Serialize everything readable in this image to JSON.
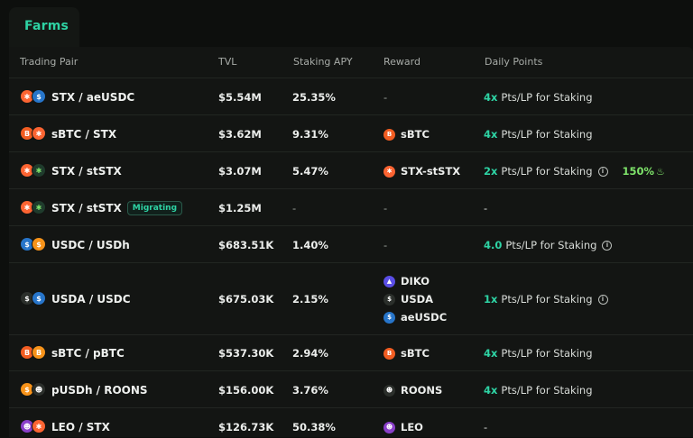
{
  "tab": {
    "label": "Farms"
  },
  "columns": [
    "Trading Pair",
    "TVL",
    "Staking APY",
    "Reward",
    "Daily Points"
  ],
  "colors": {
    "accent": "#2ed3a4",
    "boost": "#7ee36a",
    "stx": "#fc6432",
    "usdc": "#2775ca",
    "btc": "#f7931a"
  },
  "rows": [
    {
      "pair": "STX / aeUSDC",
      "tvl": "$5.54M",
      "apy": "25.35%",
      "rewards": [
        "-"
      ],
      "points_mult": "4x",
      "points_text": "Pts/LP for Staking"
    },
    {
      "pair": "sBTC / STX",
      "tvl": "$3.62M",
      "apy": "9.31%",
      "rewards": [
        "sBTC"
      ],
      "points_mult": "4x",
      "points_text": "Pts/LP for Staking"
    },
    {
      "pair": "STX / stSTX",
      "tvl": "$3.07M",
      "apy": "5.47%",
      "rewards": [
        "STX-stSTX"
      ],
      "points_mult": "2x",
      "points_text": "Pts/LP for Staking",
      "boost": "150%"
    },
    {
      "pair": "STX / stSTX",
      "badge": "Migrating",
      "tvl": "$1.25M",
      "apy": "-",
      "rewards": [
        "-"
      ],
      "points_dash": "-"
    },
    {
      "pair": "USDC / USDh",
      "tvl": "$683.51K",
      "apy": "1.40%",
      "rewards": [
        "-"
      ],
      "points_mult": "4.0",
      "points_text": "Pts/LP for Staking"
    },
    {
      "pair": "USDA / USDC",
      "tvl": "$675.03K",
      "apy": "2.15%",
      "rewards": [
        "DIKO",
        "USDA",
        "aeUSDC"
      ],
      "points_mult": "1x",
      "points_text": "Pts/LP for Staking"
    },
    {
      "pair": "sBTC / pBTC",
      "tvl": "$537.30K",
      "apy": "2.94%",
      "rewards": [
        "sBTC"
      ],
      "points_mult": "4x",
      "points_text": "Pts/LP for Staking"
    },
    {
      "pair": "pUSDh / ROONS",
      "tvl": "$156.00K",
      "apy": "3.76%",
      "rewards": [
        "ROONS"
      ],
      "points_mult": "4x",
      "points_text": "Pts/LP for Staking"
    },
    {
      "pair": "LEO / STX",
      "tvl": "$126.73K",
      "apy": "50.38%",
      "rewards": [
        "LEO"
      ],
      "points_dash": "-"
    }
  ]
}
